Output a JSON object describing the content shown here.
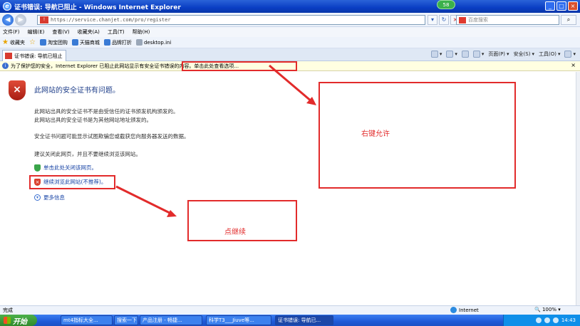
{
  "window": {
    "title": "证书错误: 导航已阻止 - Windows Internet Explorer",
    "badge": "58"
  },
  "address": {
    "url": "https://service.chanjet.com/pro/register",
    "search_placeholder": "百度搜索"
  },
  "menu": [
    "文件(F)",
    "编辑(E)",
    "查看(V)",
    "收藏夹(A)",
    "工具(T)",
    "帮助(H)"
  ],
  "favorites": {
    "label": "收藏夹",
    "items": [
      "淘宝团购",
      "天猫商城",
      "品牌打折",
      "desktop.ini"
    ]
  },
  "tab": {
    "label": "证书错误: 导航已阻止"
  },
  "commands": [
    "页面(P)",
    "安全(S)",
    "工具(O)"
  ],
  "infobar": {
    "text": "为了保护您的安全，Internet Explorer 已阻止此网站显示有安全证书错误的内容。单击此处查看选项..."
  },
  "error": {
    "title": "此网站的安全证书有问题。",
    "lines": [
      "此网站出具的安全证书不是由受信任的证书颁发机构颁发的。",
      "此网站出具的安全证书是为其他网站地址颁发的。",
      "安全证书问题可能显示试图欺骗您或截获您向服务器发送的数据。",
      "建议关闭此网页，并且不要继续浏览该网站。"
    ],
    "close_option": "单击此处关闭该网页。",
    "continue_option": "继续浏览此网站(不推荐)。",
    "more_info": "更多信息"
  },
  "annotations": {
    "right_click": "右键允许",
    "click_continue": "点继续"
  },
  "status": {
    "left": "完成",
    "zone": "Internet",
    "zoom": "100%"
  },
  "taskbar": {
    "start": "开始",
    "items": [
      "mt4指标大全...",
      "搜索一下",
      "产品注册 - 畅捷...",
      "科学T3___Jiuve等...",
      "证书错误: 导航已..."
    ],
    "time": "14:43"
  },
  "colors": {
    "annotation": "#e22b2b",
    "titlebar": "#0a3ec4",
    "link": "#1844a6"
  }
}
